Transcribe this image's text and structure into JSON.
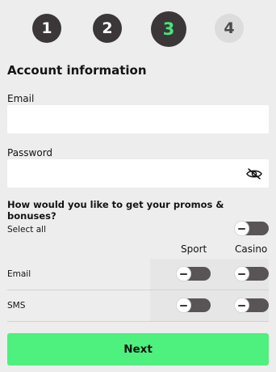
{
  "stepper": {
    "steps": [
      {
        "label": "1",
        "state": "done"
      },
      {
        "label": "2",
        "state": "done"
      },
      {
        "label": "3",
        "state": "active"
      },
      {
        "label": "4",
        "state": "todo"
      }
    ]
  },
  "form": {
    "heading": "Account information",
    "email_label": "Email",
    "email_value": "",
    "password_label": "Password",
    "password_value": ""
  },
  "promos": {
    "question": "How would you like to get your promos & bonuses?",
    "select_all_label": "Select all",
    "select_all_on": false,
    "columns": [
      "Sport",
      "Casino"
    ],
    "rows": [
      {
        "label": "Email",
        "sport_on": false,
        "casino_on": false
      },
      {
        "label": "SMS",
        "sport_on": false,
        "casino_on": false
      }
    ]
  },
  "actions": {
    "next_label": "Next"
  },
  "colors": {
    "accent_green": "#4ef07e",
    "active_step_text": "#45e67a",
    "dark": "#3b3738"
  },
  "icons": {
    "password_visibility": "eye-slash-icon"
  }
}
